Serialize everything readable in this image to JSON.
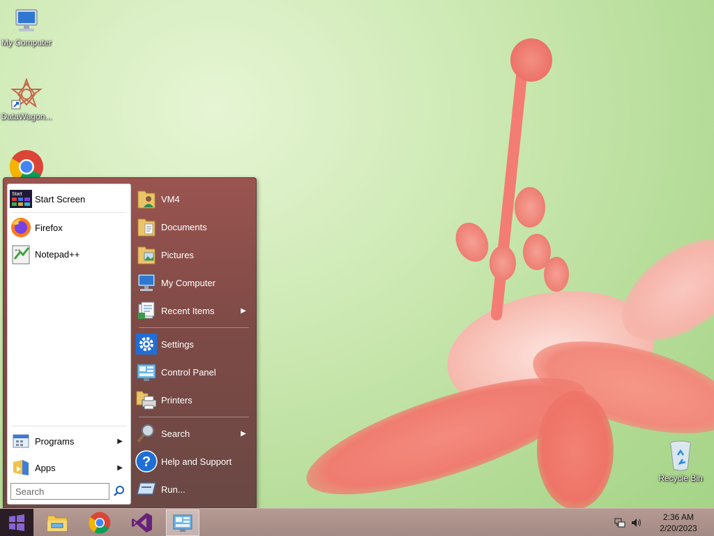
{
  "desktop": {
    "icons": [
      {
        "label": "My Computer"
      },
      {
        "label": "DataWagon..."
      },
      {
        "label": ""
      },
      {
        "label": "Recycle Bin"
      }
    ]
  },
  "start_menu": {
    "left": {
      "items": [
        {
          "label": "Start Screen",
          "icon": "start-screen-icon"
        },
        {
          "label": "Firefox",
          "icon": "firefox-icon"
        },
        {
          "label": "Notepad++",
          "icon": "notepad-plus-plus-icon"
        }
      ],
      "bottom": [
        {
          "label": "Programs",
          "icon": "programs-icon"
        },
        {
          "label": "Apps",
          "icon": "apps-icon"
        }
      ],
      "search_placeholder": "Search"
    },
    "right": {
      "items": [
        {
          "label": "VM4",
          "icon": "user-folder-icon"
        },
        {
          "label": "Documents",
          "icon": "documents-folder-icon"
        },
        {
          "label": "Pictures",
          "icon": "pictures-folder-icon"
        },
        {
          "label": "My Computer",
          "icon": "computer-icon"
        },
        {
          "label": "Recent Items",
          "icon": "recent-items-icon"
        },
        {
          "label": "Settings",
          "icon": "gear-icon"
        },
        {
          "label": "Control Panel",
          "icon": "control-panel-icon"
        },
        {
          "label": "Printers",
          "icon": "printer-icon"
        },
        {
          "label": "Search",
          "icon": "search-icon"
        },
        {
          "label": "Help and Support",
          "icon": "help-icon"
        },
        {
          "label": "Run...",
          "icon": "run-icon"
        }
      ]
    }
  },
  "taskbar": {
    "pinned": [
      "file-explorer-icon",
      "chrome-icon",
      "visual-studio-icon",
      "control-panel-icon"
    ],
    "clock": {
      "time": "2:36 AM",
      "date": "2/20/2023"
    }
  }
}
